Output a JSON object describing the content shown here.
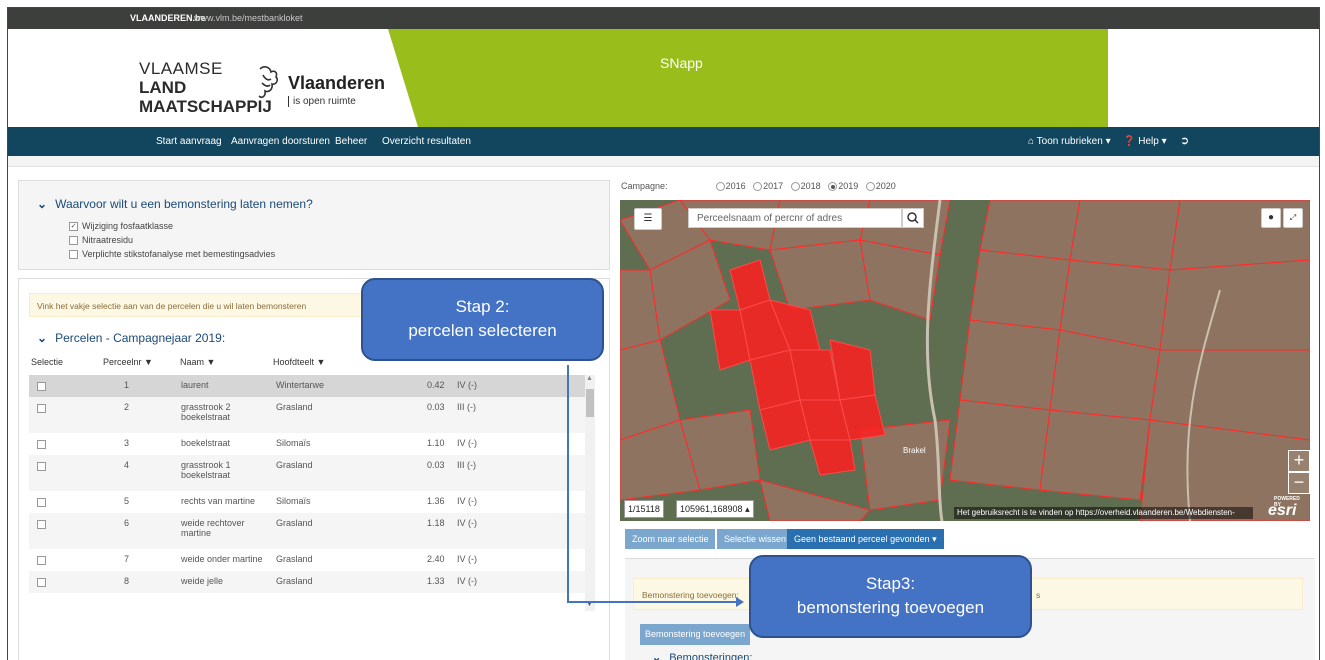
{
  "topbar": {
    "brand": "VLAANDEREN.be",
    "url": "www.vlm.be/mestbankloket"
  },
  "header": {
    "vlm_line1": "VLAAMSE",
    "vlm_line2": "LAND",
    "vlm_line3": "MAATSCHAPPIJ",
    "vlaanderen": "Vlaanderen",
    "vlaanderen_sub": "is open ruimte",
    "app_name": "SNapp"
  },
  "nav": {
    "items": [
      "Start aanvraag",
      "Aanvragen doorsturen",
      "Beheer",
      "Overzicht resultaten"
    ],
    "rubrieken": "Toon rubrieken",
    "help": "Help"
  },
  "question": {
    "title": "Waarvoor wilt u een bemonstering laten nemen?",
    "options": [
      {
        "label": "Wijziging fosfaatklasse",
        "checked": true
      },
      {
        "label": "Nitraatresidu",
        "checked": false
      },
      {
        "label": "Verplichte stikstofanalyse met bemestingsadvies",
        "checked": false
      }
    ]
  },
  "percelen": {
    "info": "Vink het vakje selectie aan van de percelen die u wil laten bemonsteren",
    "title": "Percelen - Campagnejaar 2019:",
    "headers": [
      "Selectie",
      "Perceelnr",
      "Naam",
      "Hoofdteelt"
    ],
    "rows": [
      {
        "nr": "1",
        "naam": "laurent",
        "teelt": "Wintertarwe",
        "opp": "0.42",
        "klasse": "IV (-)"
      },
      {
        "nr": "2",
        "naam": "grasstrook 2 boekelstraat",
        "teelt": "Grasland",
        "opp": "0.03",
        "klasse": "III (-)"
      },
      {
        "nr": "3",
        "naam": "boekelstraat",
        "teelt": "Silomaïs",
        "opp": "1.10",
        "klasse": "IV (-)"
      },
      {
        "nr": "4",
        "naam": "grasstrook 1 boekelstraat",
        "teelt": "Grasland",
        "opp": "0.03",
        "klasse": "III (-)"
      },
      {
        "nr": "5",
        "naam": "rechts van martine",
        "teelt": "Silomaïs",
        "opp": "1.36",
        "klasse": "IV (-)"
      },
      {
        "nr": "6",
        "naam": "weide rechtover martine",
        "teelt": "Grasland",
        "opp": "1.18",
        "klasse": "IV (-)"
      },
      {
        "nr": "7",
        "naam": "weide onder martine",
        "teelt": "Grasland",
        "opp": "2.40",
        "klasse": "IV (-)"
      },
      {
        "nr": "8",
        "naam": "weide jelle",
        "teelt": "Grasland",
        "opp": "1.33",
        "klasse": "IV (-)"
      }
    ]
  },
  "campagne": {
    "label": "Campagne:",
    "years": [
      "2016",
      "2017",
      "2018",
      "2019",
      "2020"
    ],
    "selected": "2019"
  },
  "map": {
    "search_placeholder": "Perceelsnaam of percnr of adres",
    "scale": "1/15118",
    "coords": "105961,168908",
    "attribution": "Het gebruiksrecht is te vinden op https://overheid.vlaanderen.be/Webdiensten-",
    "place_label": "Brakel",
    "esri": "esri",
    "powered_by": "POWERED BY"
  },
  "map_buttons": {
    "zoom_selection": "Zoom naar selectie",
    "clear_selection": "Selectie wissen",
    "not_found": "Geen bestaand perceel gevonden"
  },
  "bemonstering": {
    "warning_start": "Bemonstering toevoegen: ",
    "warning_tail": "s",
    "add_button": "Bemonstering toevoegen",
    "title": "Bemonsteringen:"
  },
  "callouts": {
    "stap2_line1": "Stap 2:",
    "stap2_line2": "percelen selecteren",
    "stap3_line1": "Stap3:",
    "stap3_line2": "bemonstering toevoegen"
  },
  "colors": {
    "nav": "#12465e",
    "green": "#99be1c",
    "callout": "#4472c4",
    "parcel": "#ff2a2a"
  }
}
